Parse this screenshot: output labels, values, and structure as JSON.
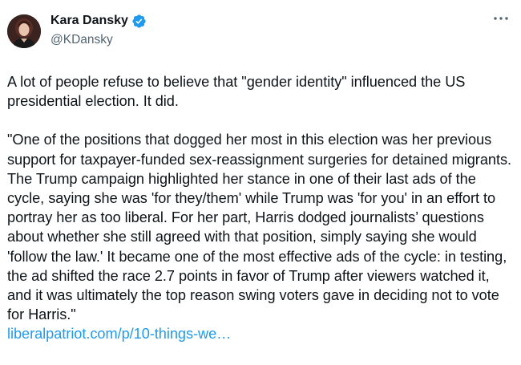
{
  "author": {
    "display_name": "Kara Dansky",
    "handle": "@KDansky",
    "verified": true,
    "verified_color": "#1d9bf0"
  },
  "more_icon": "more-horizontal-icon",
  "tweet": {
    "paragraph_1": "A lot of people refuse to believe that \"gender identity\" influenced the US presidential election. It did.",
    "paragraph_2": "\"One of the positions that dogged her most in this election was her previous support for taxpayer-funded sex-reassignment surgeries for detained migrants. The Trump campaign highlighted her stance in one of their last ads of the cycle, saying she was 'for they/them' while Trump was 'for you' in an effort to portray her as too liberal. For her part, Harris dodged journalists’ questions about whether she still agreed with that position, simply saying she would 'follow the law.' It became one of the most effective ads of the cycle: in testing, the ad shifted the race 2.7 points in favor of Trump after viewers watched it, and it was ultimately the top reason swing voters gave in deciding not to vote for Harris.\"",
    "link_text": "liberalpatriot.com/p/10-things-we…",
    "link_color": "#1d9bf0"
  }
}
